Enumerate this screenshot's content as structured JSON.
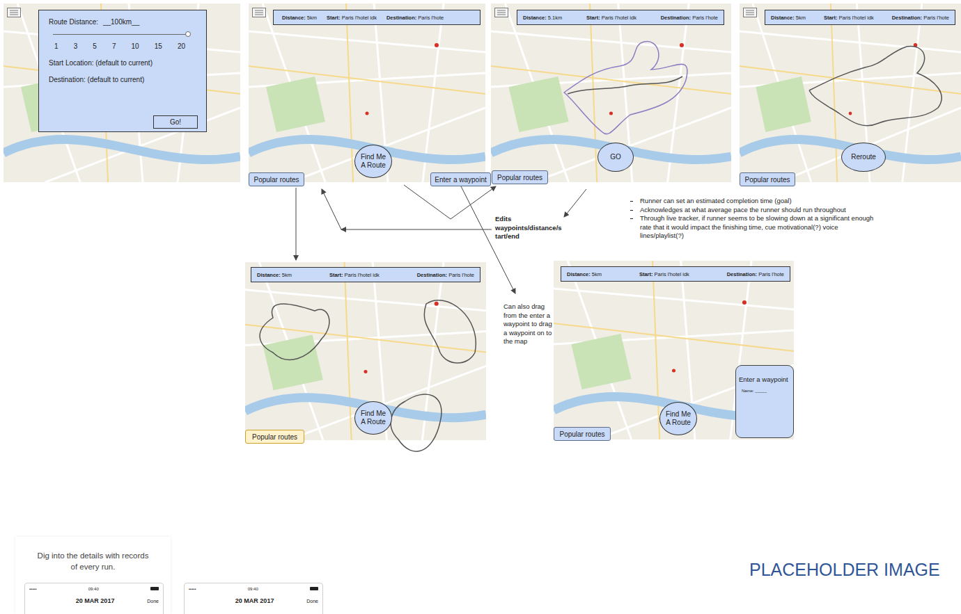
{
  "setup_screen": {
    "distance_label": "Route Distance:",
    "distance_value": "__100km__",
    "slider_level": 1,
    "ticks": [
      "1",
      "3",
      "5",
      "7",
      "10",
      "15",
      "20"
    ],
    "start": "Start Location: (default to current)",
    "destination": "Destination: (default to current)",
    "go_button": "Go!"
  },
  "map_screens": [
    {
      "menu": true,
      "distance_label": "Distance:",
      "distance": "5km",
      "start_label": "Start:",
      "start": "Paris l'hotel idk",
      "destination_label": "Destination:",
      "destination": "Paris l'hote",
      "action": "Find Me A Route",
      "popular": "Popular routes",
      "popular_selected": false,
      "waypoint_button": "Enter a waypoint",
      "route": "none",
      "waypoint_dialog": null
    },
    {
      "menu": true,
      "distance_label": "Distance:",
      "distance": "5.1km",
      "start_label": "Start:",
      "start": "Paris l'hotel idk",
      "destination_label": "Destination:",
      "destination": "Paris l'hote",
      "action": "GO",
      "popular": "Popular routes",
      "popular_selected": false,
      "waypoint_button": null,
      "route": "planned",
      "waypoint_dialog": null
    },
    {
      "menu": true,
      "distance_label": "Distance:",
      "distance": "5km",
      "start_label": "Start:",
      "start": "Paris l'hotel idk",
      "destination_label": "Destination:",
      "destination": "Paris l'hote",
      "action": "Reroute",
      "popular": "Popular routes",
      "popular_selected": false,
      "waypoint_button": null,
      "route": "reroute",
      "waypoint_dialog": null
    },
    {
      "menu": false,
      "distance_label": "Distance:",
      "distance": "5km",
      "start_label": "Start:",
      "start": "Paris l'hotel idk",
      "destination_label": "Destination:",
      "destination": "Paris l'hote",
      "action": "Find Me A Route",
      "popular": "Popular routes",
      "popular_selected": true,
      "waypoint_button": null,
      "route": "alternatives",
      "waypoint_dialog": null
    },
    {
      "menu": false,
      "distance_label": "Distance:",
      "distance": "5km",
      "start_label": "Start:",
      "start": "Paris l'hotel idk",
      "destination_label": "Destination:",
      "destination": "Paris l'hote",
      "action": "Find Me A Route",
      "popular": "Popular routes",
      "popular_selected": false,
      "waypoint_button": null,
      "route": "none",
      "waypoint_dialog": {
        "title": "Enter a waypoint",
        "name_label": "Name:",
        "name_value": "_____"
      }
    }
  ],
  "annotations": {
    "edits": "Edits waypoints/distance/start/end",
    "drag": "Can also drag from the enter a waypoint to drag a waypoint on to the map",
    "notes": [
      "Runner can set an estimated completion time (goal)",
      "Acknowledges at what average pace the runner should run throughout",
      "Through live tracker, if runner seems to be slowing down at a significant enough rate that it would impact the finishing time, cue motivational(?) voice lines/playlist(?)"
    ]
  },
  "placeholder": {
    "caption": "Dig into the details with records of every run.",
    "phones": [
      {
        "signal": "•••••",
        "time": "09:40",
        "date": "20 MAR 2017",
        "done": "Done"
      },
      {
        "signal": "•••••",
        "time": "09:40",
        "date": "20 MAR 2017",
        "done": "Done"
      }
    ]
  },
  "placeholder_label": "PLACEHOLDER IMAGE"
}
